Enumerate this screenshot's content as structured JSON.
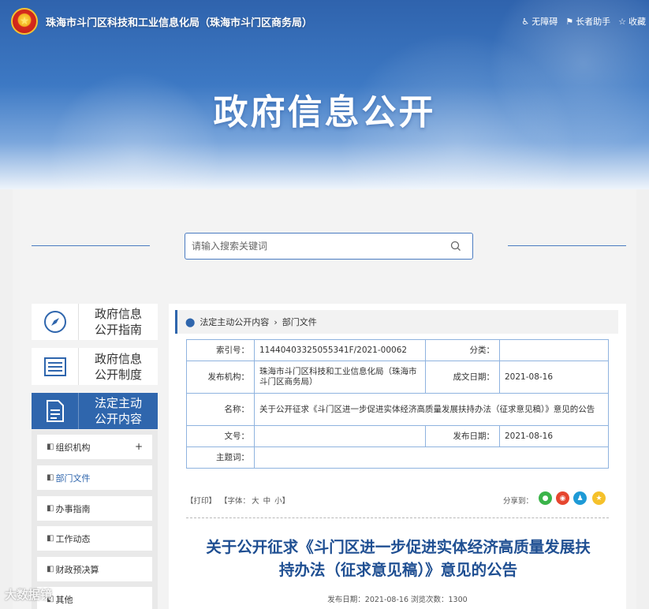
{
  "header": {
    "site_title": "珠海市斗门区科技和工业信息化局（珠海市斗门区商务局）",
    "tools": [
      {
        "icon": "accessibility-icon",
        "label": "无障碍"
      },
      {
        "icon": "elder-assist-icon",
        "label": "长者助手"
      },
      {
        "icon": "star-icon",
        "label": "收藏"
      }
    ],
    "banner_title": "政府信息公开"
  },
  "search": {
    "placeholder": "请输入搜索关键词"
  },
  "sidebar": {
    "cards": [
      {
        "icon": "compass-icon",
        "label_1": "政府信息",
        "label_2": "公开指南"
      },
      {
        "icon": "list-document-icon",
        "label_1": "政府信息",
        "label_2": "公开制度"
      },
      {
        "icon": "document-icon",
        "label_1": "法定主动",
        "label_2": "公开内容"
      }
    ],
    "sub_items": [
      {
        "label": "组织机构",
        "expand": "+"
      },
      {
        "label": "部门文件"
      },
      {
        "label": "办事指南"
      },
      {
        "label": "工作动态"
      },
      {
        "label": "财政预决算"
      },
      {
        "label": "其他"
      }
    ]
  },
  "breadcrumb": {
    "root": "法定主动公开内容",
    "separator": "›",
    "current": "部门文件"
  },
  "info": {
    "index_no_label": "索引号：",
    "index_no": "11440403325055341F/2021-00062",
    "category_label": "分类：",
    "category": "",
    "publisher_label": "发布机构：",
    "publisher": "珠海市斗门区科技和工业信息化局（珠海市斗门区商务局）",
    "created_label": "成文日期：",
    "created": "2021-08-16",
    "name_label": "名称：",
    "name": "关于公开征求《斗门区进一步促进实体经济高质量发展扶持办法（征求意见稿）》意见的公告",
    "doc_no_label": "文号：",
    "doc_no": "",
    "published_label": "发布日期：",
    "published": "2021-08-16",
    "subject_label": "主题词：",
    "subject": ""
  },
  "toolbar": {
    "print": "【打印】",
    "font_label": "【字体：",
    "font_large": "大",
    "font_medium": "中",
    "font_small": "小】",
    "share_label": "分享到：",
    "share_icons": [
      "wechat-icon",
      "weibo-icon",
      "qq-icon",
      "qzone-icon"
    ]
  },
  "article": {
    "title_line_1": "关于公开征求《斗门区进一步促进实体经济高质量发展扶",
    "title_line_2": "持办法（征求意见稿）》意见的公告",
    "meta": "发布日期：2021-08-16 浏览次数：1300"
  },
  "watermark": "大数据镜",
  "colors": {
    "primary": "#2f66ad",
    "title_blue": "#1f4f92",
    "wechat": "#3bb44a",
    "weibo": "#e6462f",
    "qq": "#1e9ad6",
    "qzone": "#f5c12b"
  }
}
